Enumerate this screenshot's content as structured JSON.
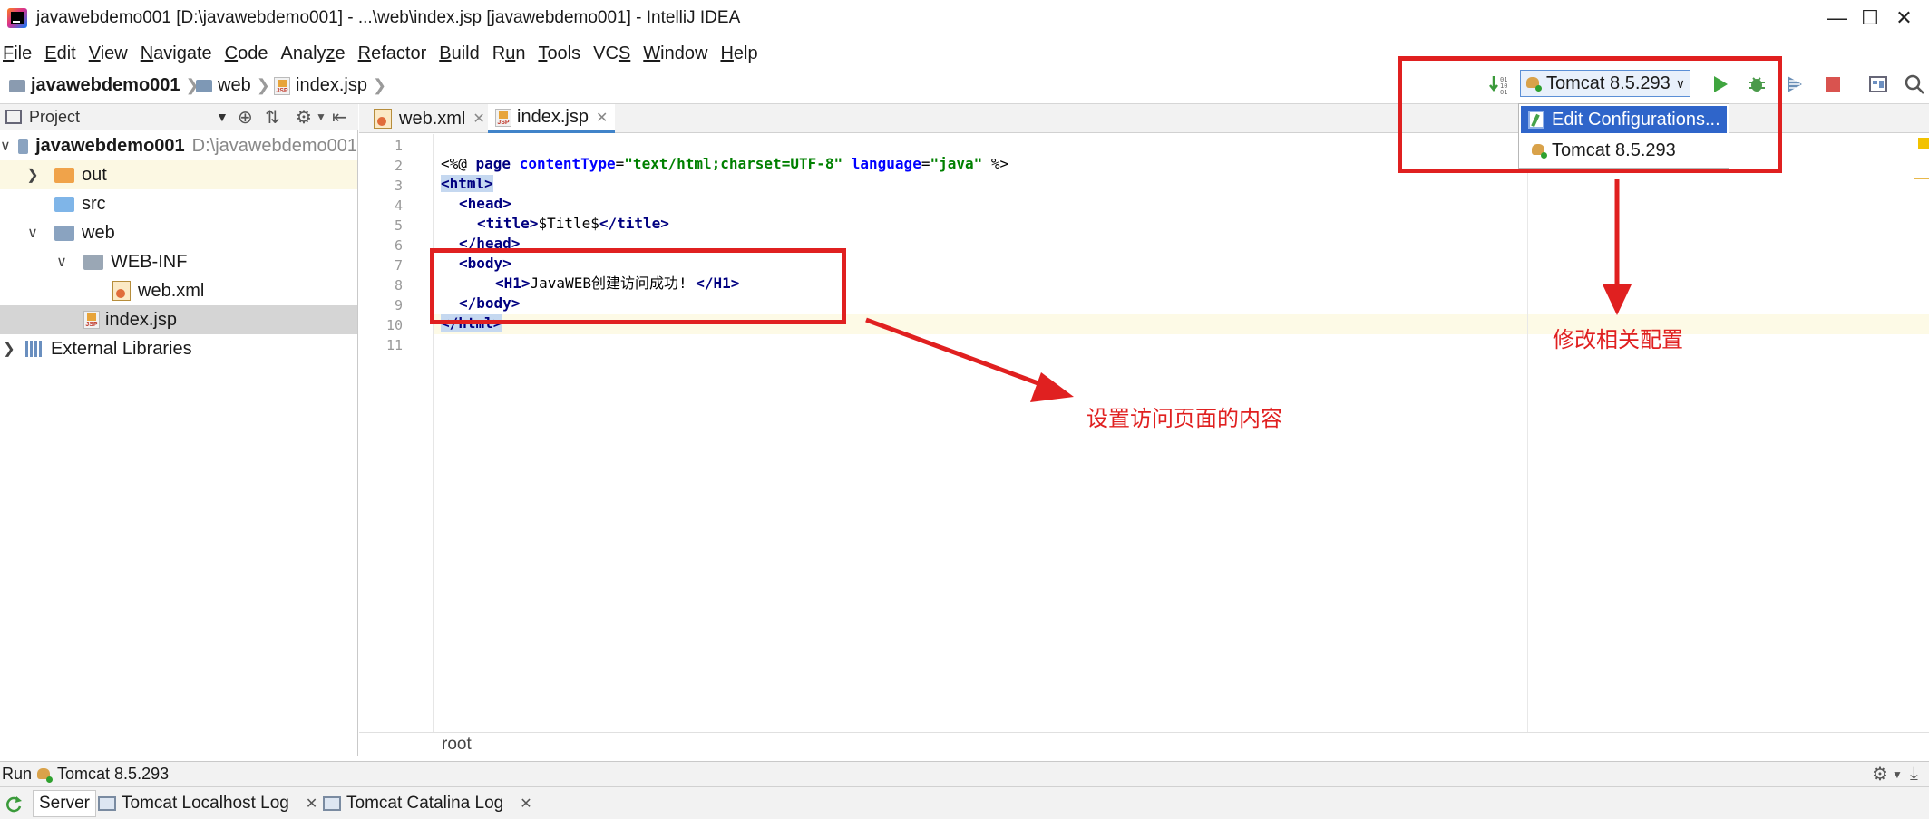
{
  "window": {
    "title": "javawebdemo001 [D:\\javawebdemo001] - ...\\web\\index.jsp [javawebdemo001] - IntelliJ IDEA"
  },
  "menu": [
    {
      "pre": "",
      "mn": "F",
      "post": "ile"
    },
    {
      "pre": "",
      "mn": "E",
      "post": "dit"
    },
    {
      "pre": "",
      "mn": "V",
      "post": "iew"
    },
    {
      "pre": "",
      "mn": "N",
      "post": "avigate"
    },
    {
      "pre": "",
      "mn": "C",
      "post": "ode"
    },
    {
      "pre": "Analy",
      "mn": "z",
      "post": "e"
    },
    {
      "pre": "",
      "mn": "R",
      "post": "efactor"
    },
    {
      "pre": "",
      "mn": "B",
      "post": "uild"
    },
    {
      "pre": "R",
      "mn": "u",
      "post": "n"
    },
    {
      "pre": "",
      "mn": "T",
      "post": "ools"
    },
    {
      "pre": "VC",
      "mn": "S",
      "post": ""
    },
    {
      "pre": "",
      "mn": "W",
      "post": "indow"
    },
    {
      "pre": "",
      "mn": "H",
      "post": "elp"
    }
  ],
  "navbar": {
    "crumbs": [
      "javawebdemo001",
      "web",
      "index.jsp"
    ]
  },
  "run_config": {
    "selected": "Tomcat 8.5.293",
    "options": [
      "Edit Configurations...",
      "Tomcat 8.5.293"
    ]
  },
  "project": {
    "header": "Project",
    "root": "javawebdemo001",
    "root_path": "D:\\javawebdemo001",
    "items": [
      "out",
      "src",
      "web",
      "WEB-INF",
      "web.xml",
      "index.jsp"
    ],
    "external": "External Libraries"
  },
  "editor": {
    "tabs": [
      "web.xml",
      "index.jsp"
    ],
    "line_numbers": [
      "1",
      "2",
      "3",
      "4",
      "5",
      "6",
      "7",
      "8",
      "9",
      "10",
      "11"
    ],
    "code": {
      "l2_a": "<%@ ",
      "l2_b": "page",
      "l2_c": " contentType",
      "l2_d": "=",
      "l2_e": "\"text/html;charset=UTF-8\"",
      "l2_f": " language",
      "l2_g": "=",
      "l2_h": "\"java\"",
      "l2_i": " %>",
      "l3": "<html>",
      "l4": "<head>",
      "l5_a": "<title>",
      "l5_b": "$Title$",
      "l5_c": "</title>",
      "l6": "</head>",
      "l7": "<body>",
      "l8_a": "<H1>",
      "l8_b": "JavaWEB创建访问成功! ",
      "l8_c": "</H1>",
      "l9": "</body>",
      "l10": "</html>"
    },
    "breadcrumb": "root"
  },
  "run_panel": {
    "label": "Run",
    "config": "Tomcat 8.5.293",
    "tabs": [
      "Server",
      "Tomcat Localhost Log",
      "Tomcat Catalina Log"
    ]
  },
  "annotations": {
    "content": "设置访问页面的内容",
    "config": "修改相关配置"
  },
  "colors": {
    "annotation_red": "#e02020",
    "selection_blue": "#2f65ca",
    "tag_navy": "#000080",
    "string_green": "#008000"
  }
}
